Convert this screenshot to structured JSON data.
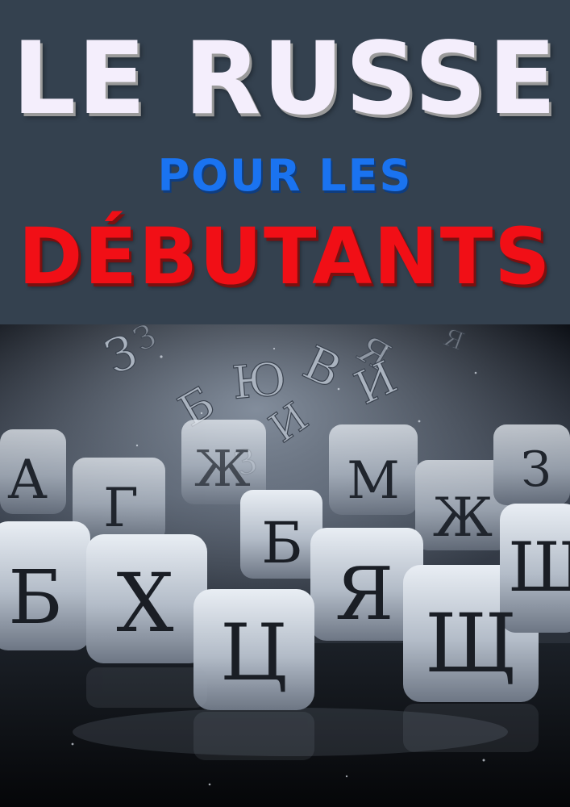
{
  "title": {
    "line1": "LE RUSSE",
    "line2": "POUR LES",
    "line3": "DÉBUTANTS"
  },
  "image": {
    "floating_letters": [
      "З",
      "З",
      "Я",
      "В",
      "Ю",
      "Б",
      "И",
      "И",
      "З",
      "Я"
    ],
    "cube_letters": [
      "А",
      "Г",
      "Ж",
      "М",
      "З",
      "Ж",
      "Б",
      "Б",
      "Х",
      "Я",
      "Щ",
      "Ш",
      "Ц"
    ]
  },
  "colors": {
    "background": "#34414f",
    "line1": "#f4eefc",
    "line2": "#1a73f0",
    "line3": "#f10f16"
  }
}
